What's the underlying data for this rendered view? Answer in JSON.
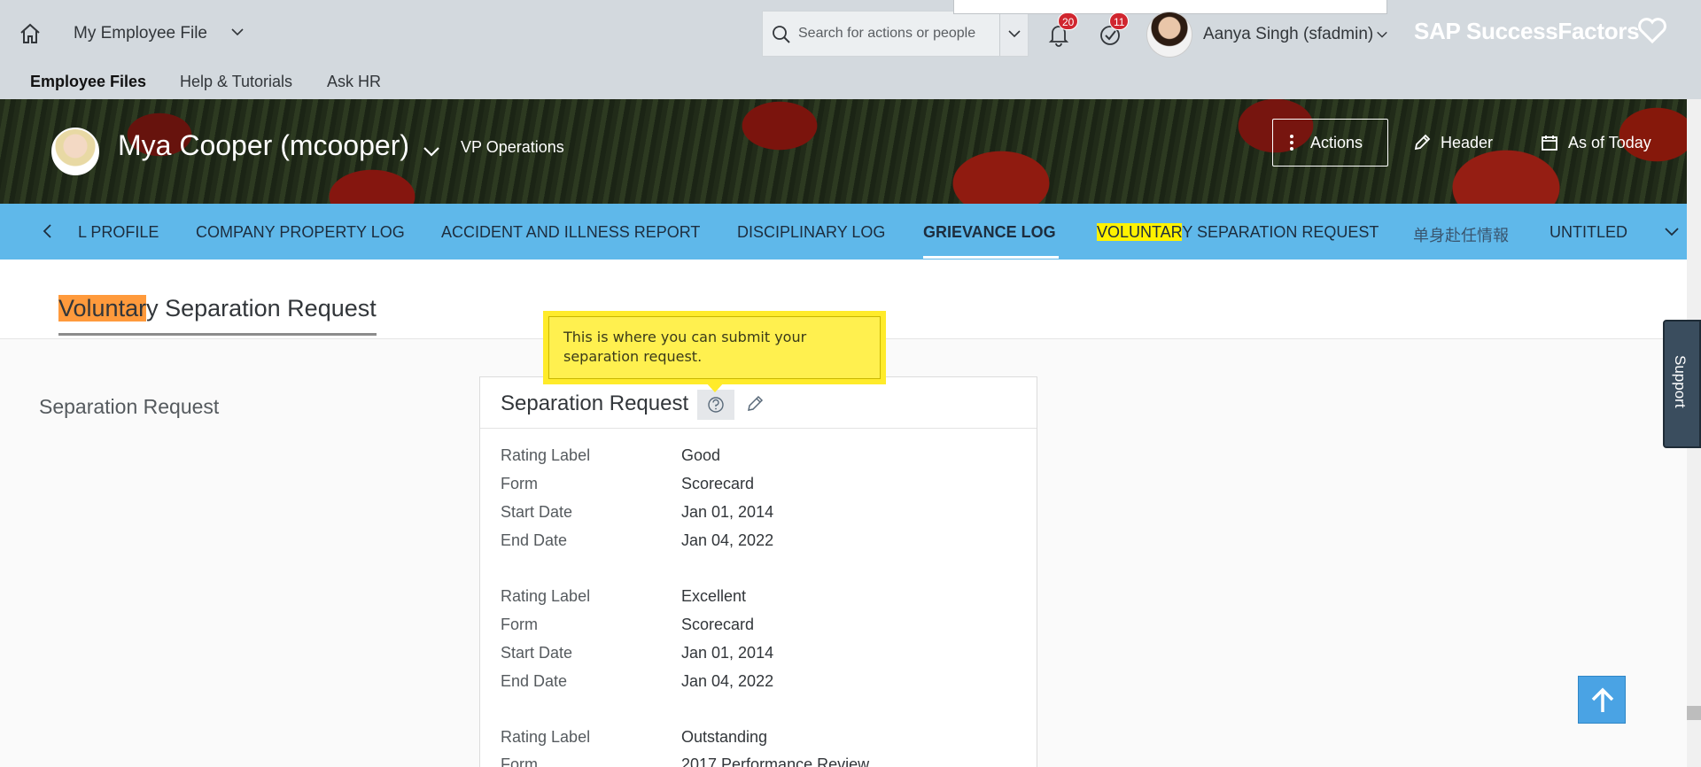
{
  "shell": {
    "app_title": "My Employee File",
    "search_placeholder": "Search for actions or people",
    "notifications_count": "20",
    "todo_count": "11",
    "user_name": "Aanya Singh (sfadmin)",
    "brand": "SAP SuccessFactors",
    "links": [
      "Employee Files",
      "Help & Tutorials",
      "Ask HR"
    ]
  },
  "header": {
    "employee_name": "Mya Cooper (mcooper)",
    "employee_title": "VP Operations",
    "actions_label": "Actions",
    "header_label": "Header",
    "as_of_label": "As of Today"
  },
  "tabs": {
    "items": [
      "L PROFILE",
      "COMPANY PROPERTY LOG",
      "ACCIDENT AND ILLNESS REPORT",
      "DISCIPLINARY LOG",
      "GRIEVANCE LOG",
      "Y SEPARATION REQUEST",
      "单身赴任情報",
      "UNTITLED"
    ],
    "highlight_prefix": "VOLUNTAR",
    "active": "GRIEVANCE LOG"
  },
  "section": {
    "title_highlight": "Voluntar",
    "title_rest": "y Separation Request",
    "side_label": "Separation Request"
  },
  "tooltip": {
    "text": "This is where you can submit your separation request."
  },
  "card": {
    "title": "Separation Request",
    "records": [
      {
        "rating_label_key": "Rating Label",
        "rating_label": "Good",
        "form_key": "Form",
        "form": "Scorecard",
        "start_key": "Start Date",
        "start": "Jan 01, 2014",
        "end_key": "End Date",
        "end": "Jan 04, 2022"
      },
      {
        "rating_label_key": "Rating Label",
        "rating_label": "Excellent",
        "form_key": "Form",
        "form": "Scorecard",
        "start_key": "Start Date",
        "start": "Jan 01, 2014",
        "end_key": "End Date",
        "end": "Jan 04, 2022"
      },
      {
        "rating_label_key": "Rating Label",
        "rating_label": "Outstanding",
        "form_key": "Form",
        "form": "2017 Performance Review"
      }
    ]
  },
  "support": {
    "label": "Support"
  },
  "colors": {
    "tab_bar": "#5fb8ea",
    "shell": "#d3d9de",
    "tooltip": "#fff04f",
    "highlight_yellow": "#fff200",
    "highlight_orange": "#ff9a3c",
    "badge": "#d0262f"
  }
}
